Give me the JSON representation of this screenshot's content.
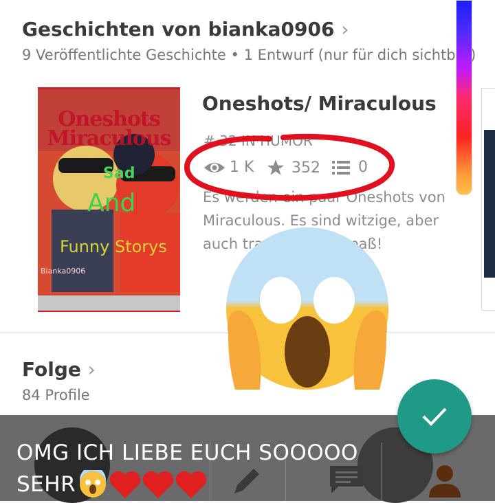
{
  "stories_section": {
    "title": "Geschichten von bianka0906",
    "chevron": "›",
    "subtitle": "9 Veröffentlichte Geschichte • 1 Entwurf (nur für dich sichtbar)"
  },
  "story": {
    "title": "Oneshots/ Miraculous",
    "rank": "# 32 IN HUMOR",
    "reads": "1 K",
    "votes": "352",
    "parts": "0",
    "description_lines": [
      "Es werden ein paar Oneshots von",
      "Miraculous. Es sind witzige, aber",
      "auch traurige. Viel Spaß!"
    ],
    "cover": {
      "title": "Oneshots Miraculous",
      "words": [
        "Sad",
        "And",
        "Funny Storys"
      ],
      "author": "Bianka0906"
    }
  },
  "following_section": {
    "title": "Folge",
    "chevron": "›",
    "subtitle": "84 Profile"
  },
  "overlay_caption": {
    "line1": "OMG ICH LIEBE EUCH SOOOOO",
    "line2": "SEHR"
  },
  "fab": {
    "icon": "check-icon"
  },
  "colors": {
    "annotation": "#e0101e",
    "fab": "#1f9a86",
    "overlay": "#6a6a6a"
  }
}
